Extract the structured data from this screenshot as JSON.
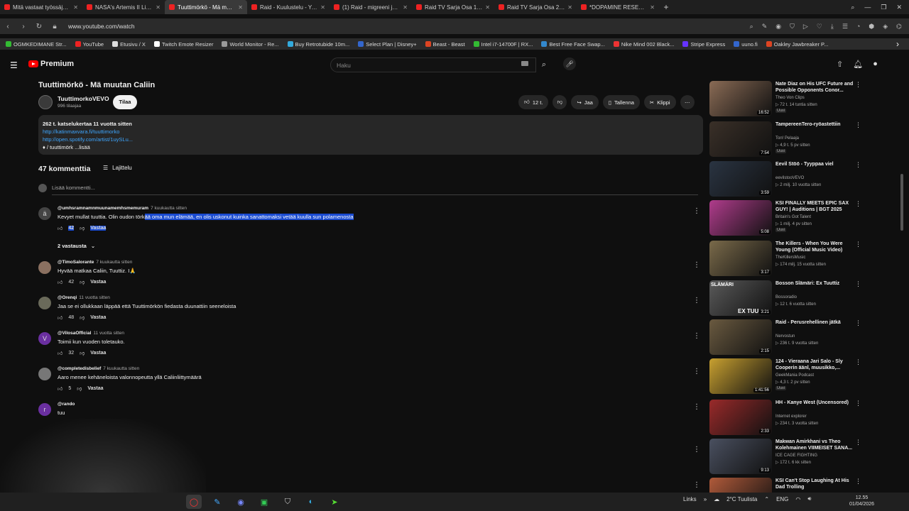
{
  "browser": {
    "tabs": [
      {
        "label": "Mitä vastaat työssäjälle?",
        "color": "#e22"
      },
      {
        "label": "NASA's Artemis II Live Vie",
        "color": "#e22"
      },
      {
        "label": "Tuuttimörkö - Mä muutan",
        "color": "#e22"
      },
      {
        "label": "Raid - Kuulustelu - YouTub",
        "color": "#e22"
      },
      {
        "label": "(1) Raid - migreeni jalassa",
        "color": "#e22"
      },
      {
        "label": "Raid TV Sarja Osa 1. Lasin",
        "color": "#e22"
      },
      {
        "label": "Raid TV Sarja Osa 2. Poliisi",
        "color": "#e22"
      },
      {
        "label": "*DOPAMINE RESET* Ha",
        "color": "#e22"
      }
    ],
    "new_tab": "+",
    "url": "www.youtube.com/watch",
    "bookmarks": [
      {
        "label": "OGMKEDIMANE Str...",
        "color": "#3b3"
      },
      {
        "label": "YouTube",
        "color": "#e22"
      },
      {
        "label": "Etusivu / X",
        "color": "#ddd"
      },
      {
        "label": "Twitch Emote Resizer",
        "color": "#fff"
      },
      {
        "label": "World Monitor - Re...",
        "color": "#999"
      },
      {
        "label": "Buy Retrotubide 10m...",
        "color": "#3ad"
      },
      {
        "label": "Select Plan | Disney+",
        "color": "#36c"
      },
      {
        "label": "Beast - Beast",
        "color": "#d42"
      },
      {
        "label": "Intel i7-14700F | RX...",
        "color": "#3b3"
      },
      {
        "label": "Best Free Face Swap...",
        "color": "#38c"
      },
      {
        "label": "Nike Mind 002 Black...",
        "color": "#e33"
      },
      {
        "label": "Stripe Express",
        "color": "#63f"
      },
      {
        "label": "uuno.fi",
        "color": "#36c"
      },
      {
        "label": "Oakley Jawbreaker P...",
        "color": "#d42"
      }
    ]
  },
  "youtube": {
    "logo": "Premium",
    "search_placeholder": "Haku"
  },
  "video": {
    "title": "Tuuttimörkö - Mä muutan Caliin",
    "channel": "TuuttimorkoVEVO",
    "subscribers": "996 tilaajaa",
    "subscribe_label": "Tilaa",
    "likes": "12 t.",
    "share": "Jaa",
    "save": "Tallenna",
    "clip": "Klippi",
    "description": {
      "meta": "262 t. katselukertaa  11 vuotta sitten",
      "link1": "http://katinmaxvara.fi/tuuttimorko",
      "link2": "http://open.spotify.com/artist/1uySLu...",
      "more": "♦ / tuuttimörk ...lisää"
    }
  },
  "comments": {
    "count_label": "47 kommenttia",
    "sort_label": "Lajittelu",
    "add_placeholder": "Lisää kommentti...",
    "replies_toggle": "2 vastausta",
    "items": [
      {
        "avatar": "ä",
        "author": "@umhsramnamnmuunamemhsmemuram",
        "time": "7 kuukautta sitten",
        "text_plain": "Kevyet mullat tuuttia. Olin oudon törk",
        "text_selected": "ää oma mun elämää, en olis uskonut kuinka sanattomaksi vetää kuulla sun polamenosta",
        "likes": "42",
        "reply": "Vastaa"
      },
      {
        "avatar": "",
        "author": "@TimoSalorante",
        "time": "7 kuukautta sitten",
        "text_plain": "Hyvää matkaa Caliin, Tuuttiz. I🙏",
        "text_selected": "",
        "likes": "42",
        "reply": "Vastaa"
      },
      {
        "avatar": "",
        "author": "@Orenqi",
        "time": "11 vuotta sitten",
        "text_plain": "Jaa se ei ollukkaan läppää että Tuuttimörkön fiedasta duunattiin seeneloista",
        "text_selected": "",
        "likes": "48",
        "reply": "Vastaa"
      },
      {
        "avatar": "V",
        "author": "@VilosaOfficial",
        "time": "11 vuotta sitten",
        "text_plain": "Toimii kun vuoden toletauko.",
        "text_selected": "",
        "likes": "32",
        "reply": "Vastaa"
      },
      {
        "avatar": "",
        "author": "@completedisbelief",
        "time": "7 kuukautta sitten",
        "text_plain": "Aaro menee kehäneloista valonnopeutta yllä Caliinliittymäärä",
        "text_selected": "",
        "likes": "5",
        "reply": "Vastaa"
      },
      {
        "avatar": "r",
        "author": "@rando",
        "time": "",
        "text_plain": "tuu",
        "text_selected": "",
        "likes": "",
        "reply": ""
      }
    ]
  },
  "sidebar": {
    "items": [
      {
        "title": "Nate Diaz on His UFC Future and Possible Opponents Conor...",
        "channel": "Theo Von Clips",
        "views": "72 t. 14 tuntia sitten",
        "badge": "Uusi",
        "duration": "16:52",
        "thumb": "#8a6b55"
      },
      {
        "title": "TampereenTero-ryöastettiin",
        "channel": "Ton! Pelaaja",
        "views": "4,9 t. 5 pv sitten",
        "badge": "Uusi",
        "duration": "7:54",
        "thumb": "#3a3028"
      },
      {
        "title": "Eevil Stöö - Tyyppaa viel",
        "channel": "eevilstooVEVO",
        "views": "2 milj. 10 vuotta sitten",
        "badge": "",
        "duration": "3:59",
        "thumb": "#2a3442"
      },
      {
        "title": "KSI FINALLY MEETS EPIC SAX GUY! | Auditions | BGT 2025",
        "channel": "Britain's Got Talent",
        "views": "1 milj. 4 pv sitten",
        "badge": "Uusi",
        "duration": "5:08",
        "thumb": "#b03c8c"
      },
      {
        "title": "The Killers - When You Were Young (Official Music Video)",
        "channel": "TheKillersMusic",
        "views": "174 milj. 15 vuotta sitten",
        "badge": "",
        "duration": "3:17",
        "thumb": "#7a6a4a"
      },
      {
        "title": "Bosson Slämäri: Ex Tuuttiz",
        "channel": "Bossoradio",
        "views": "12 t. 6 vuotta sitten",
        "badge": "",
        "duration": "3:21",
        "thumb": "#5a5a5a",
        "overlay": "SLÄMÄRI",
        "overlay2": "EX TUU"
      },
      {
        "title": "Raid - Perusrehellinen jätkä",
        "channel": "Nervostun",
        "views": "236 t. 9 vuotta sitten",
        "badge": "",
        "duration": "2:15",
        "thumb": "#6a5a40"
      },
      {
        "title": "124 - Vieraana Jari Salo - Sly Cooperin äänl, muusikko,...",
        "channel": "GeekMania Podcast",
        "views": "4,3 t. 2 pv sitten",
        "badge": "Uusi",
        "duration": "1:41:56",
        "thumb": "#c8a030"
      },
      {
        "title": "HH - Kanye West (Uncensored)",
        "channel": "Internet explorer",
        "views": "234 t. 3 vuotta sitten",
        "badge": "",
        "duration": "2:33",
        "thumb": "#9a2a2a"
      },
      {
        "title": "Makwan Amirkhani vs Theo Kolehmainen VIIMEISET SANA...",
        "channel": "ICE CAGE FIGHTING",
        "views": "172 t. 6 kk sitten",
        "badge": "",
        "duration": "9:13",
        "thumb": "#4a5060"
      },
      {
        "title": "KSI Can't Stop Laughing At His Dad Trolling",
        "channel": "",
        "views": "",
        "badge": "",
        "duration": "",
        "thumb": "#b05a3a"
      }
    ]
  },
  "taskbar": {
    "links": "Links",
    "weather": "2°C  Tuulista",
    "lang": "ENG",
    "time": "12.55",
    "date": "01/04/2026"
  }
}
